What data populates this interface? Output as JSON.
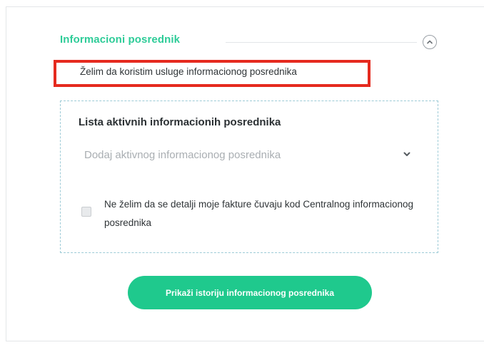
{
  "section": {
    "title": "Informacioni posrednik",
    "collapse_icon": "chevron-up-icon"
  },
  "option": {
    "label": "Želim da koristim usluge informacionog posrednika"
  },
  "panel": {
    "title": "Lista aktivnih informacionih posrednika",
    "select": {
      "value": "Dodaj aktivnog informacionog posrednika",
      "icon": "chevron-down-icon"
    },
    "checkbox": {
      "label": "Ne želim da se detalji moje fakture čuvaju kod Centralnog informacionog posrednika",
      "checked": false
    }
  },
  "history_button": {
    "label": "Prikaži istoriju informacionog posrednika"
  },
  "colors": {
    "accent": "#1fc98d",
    "title_green": "#2ecc98",
    "highlight": "#e52a1f",
    "panel_border": "#9ccad6"
  }
}
